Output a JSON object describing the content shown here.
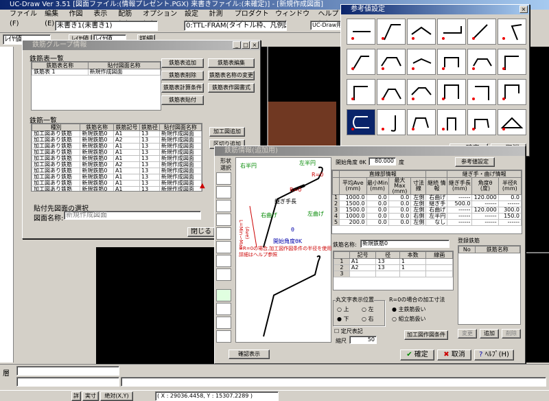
{
  "app": {
    "title": "UC-Draw Ver 3.51 [図面ファイル:(情報プレゼント.PGX) 来書きファイル:(未確定)] - [新規作成図面]"
  },
  "menu": [
    "ファイル(F)",
    "編集(E)",
    "作図(A)",
    "表示(V)",
    "配筋(B)",
    "オプション(O)",
    "設定(S)",
    "計測(M)",
    "プロダクト(P)",
    "ウィンドウ(W)",
    "ヘルプ(H)"
  ],
  "toolbar": {
    "layer_combo": "未書き1(未書き1)",
    "line_combo": "0:TTL-FRAM(タイトル枠、凡例図枠)",
    "style_combo": "UC-Draw用語",
    "layer_value": "ﾚｲﾔ値",
    "layer_btn": "ﾚｲﾔ値",
    "layer_value2": "ﾚｲﾔ値",
    "detail_btn": "詳細"
  },
  "group_dialog": {
    "title": "鉄筋グループ情報",
    "list_label": "鉄筋表一覧",
    "list_cols": [
      "鉄筋表名称",
      "貼付図面名称"
    ],
    "list_rows": [
      [
        "鉄筋表 1",
        "新規作成図面"
      ]
    ],
    "buttons": [
      "鉄筋表追加",
      "鉄筋表削除",
      "鉄筋表計算条件",
      "鉄筋表貼付",
      "鉄筋表編集",
      "鉄筋表名称の変更",
      "鉄筋表作図書式"
    ],
    "rebar_label": "鉄筋一覧",
    "rebar_cols": [
      "種別",
      "鉄筋名称",
      "鉄筋記号",
      "鉄筋径",
      "貼付図面名称"
    ],
    "rebar_rows": [
      [
        "加工図あり鉄筋",
        "新規鉄筋0",
        "A1",
        "13",
        "新規作成図面"
      ],
      [
        "加工図あり鉄筋",
        "新規鉄筋0",
        "A2",
        "13",
        "新規作成図面"
      ],
      [
        "加工図あり鉄筋",
        "新規鉄筋0",
        "A1",
        "13",
        "新規作成図面"
      ],
      [
        "加工図あり鉄筋",
        "新規鉄筋0",
        "A1",
        "13",
        "新規作成図面"
      ],
      [
        "加工図あり鉄筋",
        "新規鉄筋0",
        "A1",
        "13",
        "新規作成図面"
      ],
      [
        "加工図あり鉄筋",
        "新規鉄筋0",
        "A2",
        "13",
        "新規作成図面"
      ],
      [
        "加工図あり鉄筋",
        "新規鉄筋0",
        "A1",
        "13",
        "新規作成図面"
      ],
      [
        "加工図あり鉄筋",
        "新規鉄筋0",
        "A1",
        "13",
        "新規作成図面"
      ],
      [
        "加工図あり鉄筋",
        "新規鉄筋0",
        "A1",
        "13",
        "新規作成図面"
      ],
      [
        "加工図あり鉄筋",
        "新規鉄筋0",
        "A1",
        "13",
        "新規作成図面"
      ],
      [
        "加工図あり鉄筋",
        "新規鉄筋0",
        "A1",
        "13",
        "新規作成図面"
      ],
      [
        "加工図あり鉄筋",
        "新規鉄筋0",
        "A2",
        "13",
        "新規作成図面"
      ]
    ],
    "side_buttons": [
      "加工図追加",
      "区切り追加"
    ],
    "paste_label": "貼付先図面の選択",
    "drawing_name_label": "図面名称:",
    "drawing_name_value": "新規作成図面",
    "close_btn": "閉じる"
  },
  "ref_dialog": {
    "title": "参考値設定",
    "ok": "確定",
    "cancel": "取消"
  },
  "rebar_dialog": {
    "title": "鉄筋情報(追加用)",
    "shape_label": "形状",
    "select_label": "選択",
    "start_angle_label": "開始角度 θK",
    "start_angle_value": "80.000",
    "unit_deg": "度",
    "ref_btn": "参考値設定",
    "straight_header": "直線部情報",
    "bend_header": "継ぎ手・曲げ情報",
    "cols": [
      "平均Ave\n(mm)",
      "最小Min\n(mm)",
      "最大Max\n(mm)",
      "寸法線",
      "継続\n情報",
      "継ぎ手長\n(mm)",
      "角度θ\n(度)",
      "半径R\n(mm)"
    ],
    "rows": [
      [
        "1",
        "1000.0",
        "0.0",
        "0.0",
        "左側",
        "右曲げ",
        "------",
        "120.000",
        "0.0"
      ],
      [
        "2",
        "1500.0",
        "0.0",
        "0.0",
        "左側",
        "継ぎ手",
        "500.0",
        "------",
        "------"
      ],
      [
        "3",
        "1500.0",
        "0.0",
        "0.0",
        "左側",
        "右曲げ",
        "------",
        "120.000",
        "300.0"
      ],
      [
        "4",
        "1000.0",
        "0.0",
        "0.0",
        "右側",
        "左半円",
        "------",
        "------",
        "150.0"
      ],
      [
        "5",
        "200.0",
        "0.0",
        "0.0",
        "左側",
        "なし",
        "------",
        "------",
        "------"
      ]
    ],
    "name_label": "鉄筋名称:",
    "name_value": "新規鉄筋0",
    "sub_cols": [
      "記号",
      "径",
      "本数",
      "線画"
    ],
    "sub_rows": [
      [
        "1",
        "A1",
        "13",
        "1"
      ],
      [
        "2",
        "A2",
        "13",
        "1"
      ],
      [
        "3",
        "",
        "",
        "",
        ""
      ]
    ],
    "reg_label": "登録鉄筋",
    "reg_cols": [
      "No",
      "鉄筋名称"
    ],
    "circle_label": "丸文字表示位置",
    "circle_opts": [
      "上",
      "左",
      "下",
      "右"
    ],
    "r0_label": "R=0の場合の加工寸法",
    "r0_opts": [
      "主鉄筋扱い",
      "組立筋扱い"
    ],
    "fixed_label": "定尺表記",
    "scale_label": "縮尺",
    "scale_value": "50",
    "process_btn": "加工図作図条件",
    "change_btn": "変更",
    "add_btn": "追加",
    "delete_btn": "削除",
    "confirm_btn": "確認表示",
    "ok": "確定",
    "cancel": "取消",
    "help": "ﾍﾙﾌﾟ(H)",
    "diag_labels": [
      "右半円",
      "左半円",
      "R=0",
      "R=0",
      "継ぎ手長",
      "右曲げ",
      "左曲げ",
      "開始角度θK",
      "L=Min〜Max",
      "(Ave)",
      "θ"
    ],
    "note": "※R=0の場合,加工図作図条件の半径を使用\n詳細はヘルプ参照"
  },
  "status": {
    "b1": "詳",
    "b2": "実寸",
    "b3": "絶対(X,Y)",
    "coords": "( X : 29036.4458, Y : 15307.2289 )",
    "layer_label": "層"
  }
}
